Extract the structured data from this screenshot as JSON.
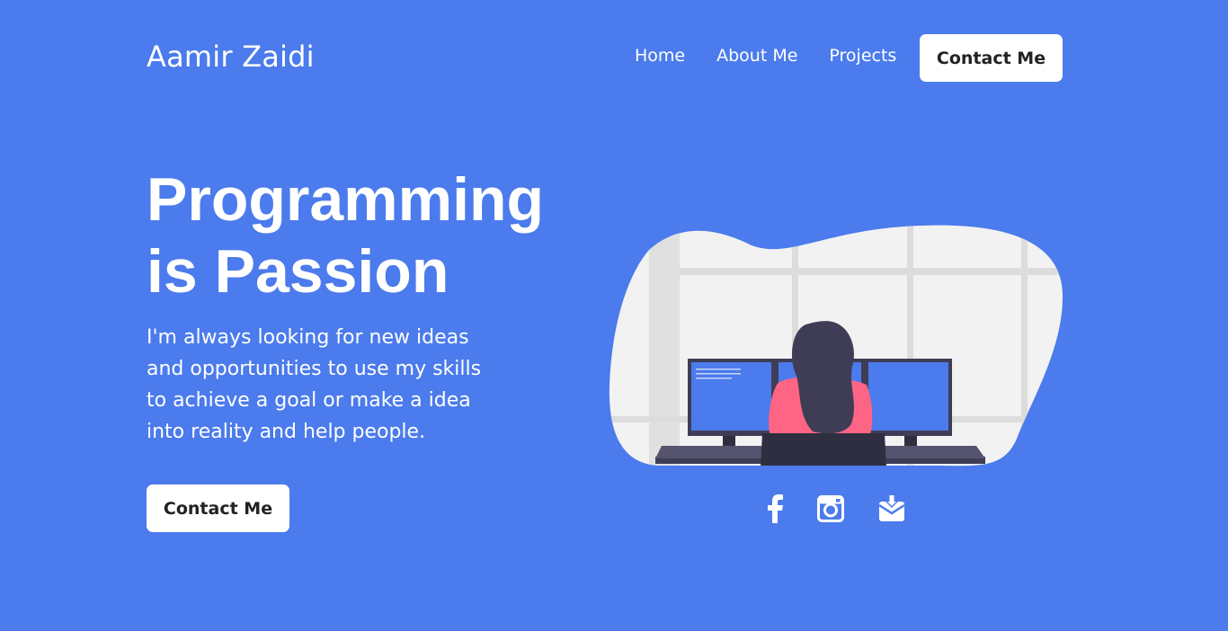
{
  "header": {
    "brand": "Aamir Zaidi",
    "nav": [
      "Home",
      "About Me",
      "Projects"
    ],
    "cta": "Contact Me"
  },
  "hero": {
    "title_lines": [
      "Programming",
      "is Passion"
    ],
    "description": "I'm always looking for new ideas and opportunities to use my skills to achieve a goal or make a idea into reality and help people.",
    "cta": "Contact Me"
  },
  "social": {
    "icons": [
      "facebook-icon",
      "instagram-icon",
      "mail-download-icon"
    ]
  },
  "colors": {
    "background": "#4b7bec",
    "button_bg": "#ffffff",
    "button_text": "#222222",
    "shirt": "#fe6584",
    "hair": "#3f3d56",
    "screen": "#4b7bec"
  }
}
